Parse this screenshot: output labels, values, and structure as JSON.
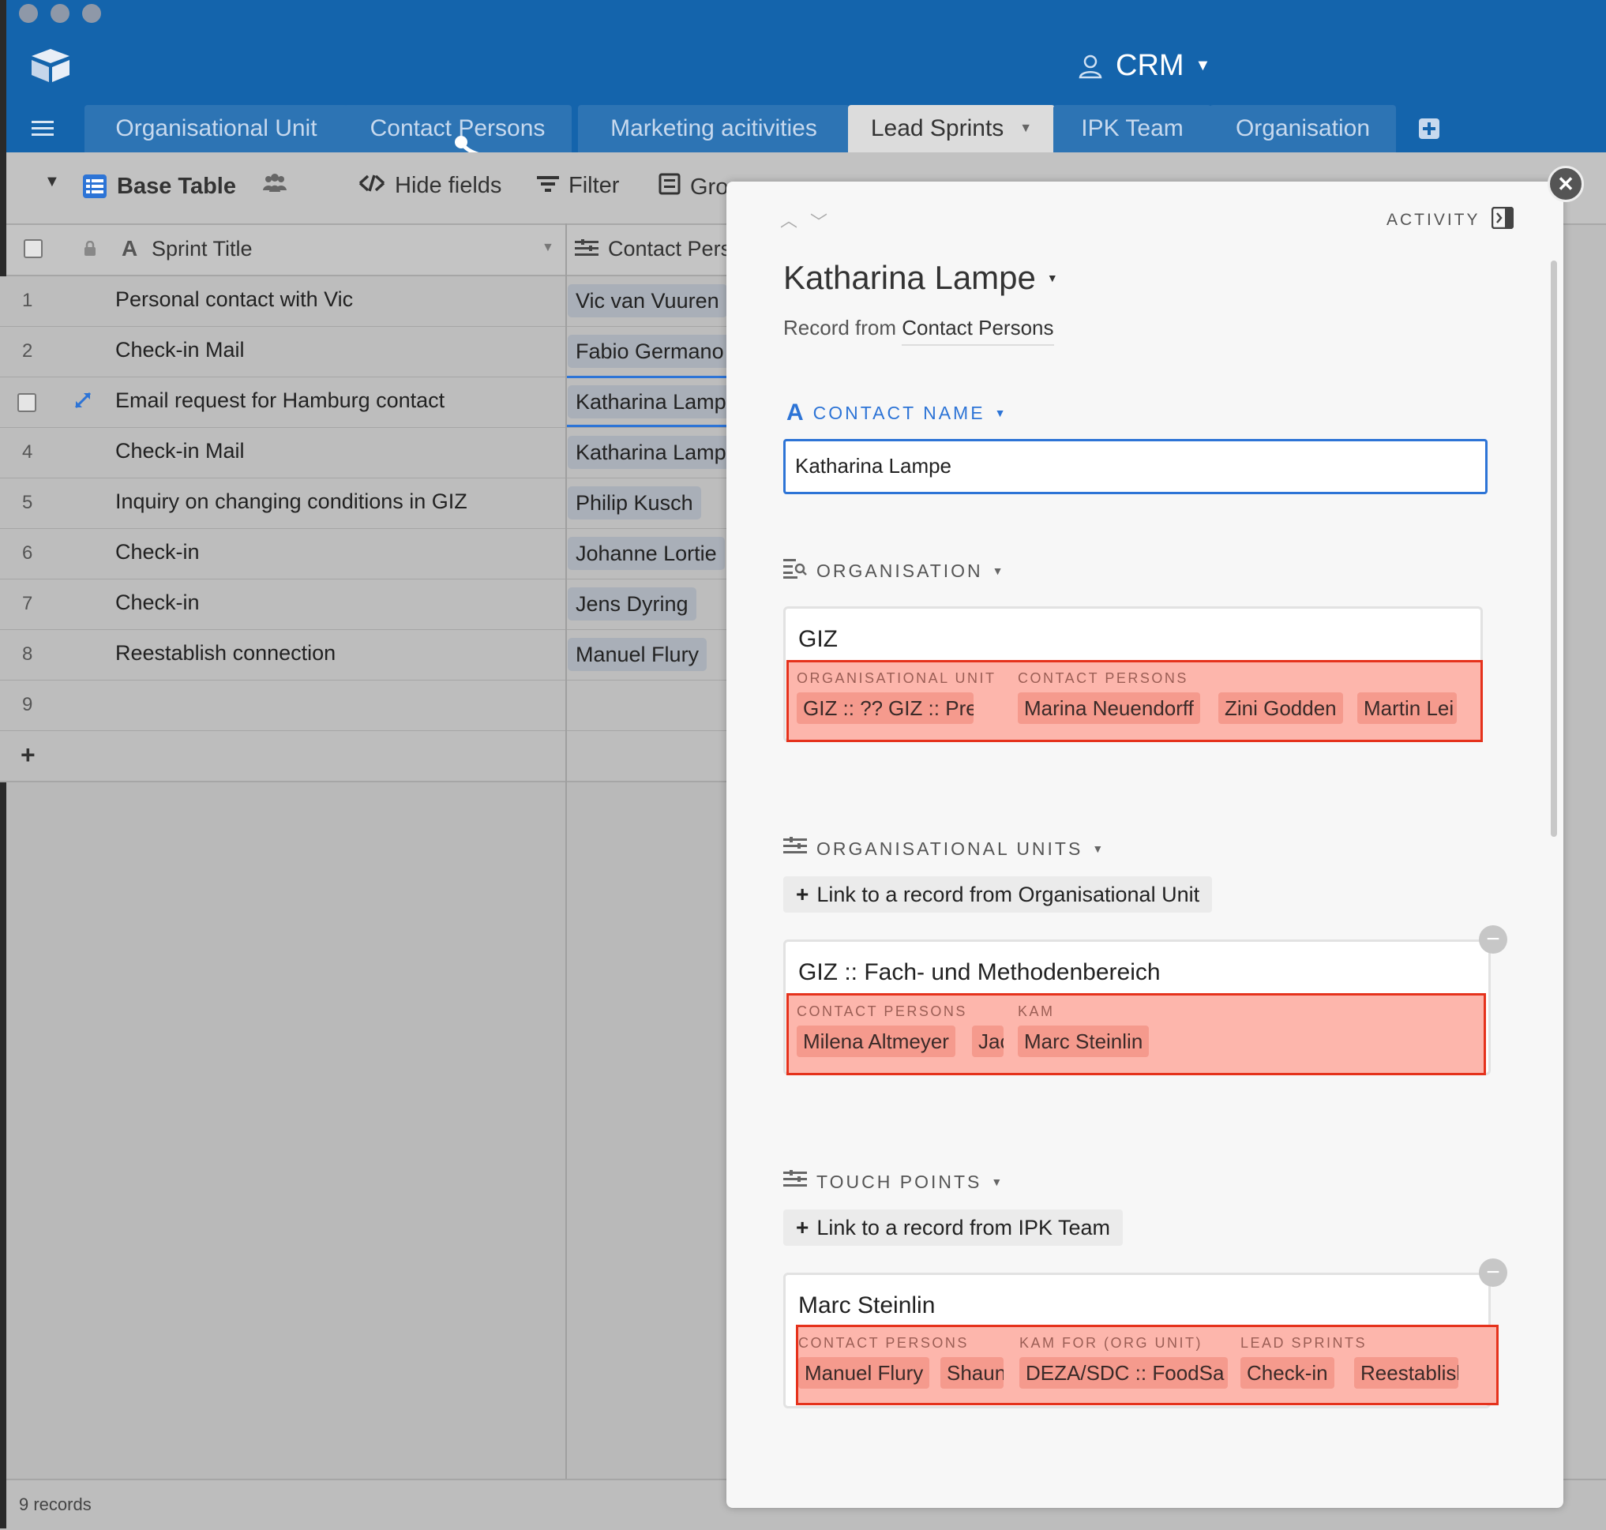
{
  "base": {
    "name": "CRM"
  },
  "tabs": [
    {
      "label": "Organisational Unit"
    },
    {
      "label": "Contact Persons"
    },
    {
      "label": "Marketing acitivities"
    },
    {
      "label": "Lead Sprints"
    },
    {
      "label": "IPK Team"
    },
    {
      "label": "Organisation"
    }
  ],
  "toolbar": {
    "view_name": "Base Table",
    "hide_fields": "Hide fields",
    "filter": "Filter",
    "group": "Group"
  },
  "grid": {
    "columns": [
      {
        "label": "Sprint Title"
      },
      {
        "label": "Contact Persons"
      }
    ],
    "rows": [
      {
        "num": "1",
        "title": "Personal contact with Vic",
        "contact": "Vic van Vuuren"
      },
      {
        "num": "2",
        "title": "Check-in Mail",
        "contact": "Fabio Germano"
      },
      {
        "num": "",
        "title": "Email request for Hamburg contact",
        "contact": "Katharina Lampe"
      },
      {
        "num": "4",
        "title": "Check-in Mail",
        "contact": "Katharina Lampe"
      },
      {
        "num": "5",
        "title": "Inquiry on changing conditions in GIZ",
        "contact": "Philip Kusch"
      },
      {
        "num": "6",
        "title": "Check-in",
        "contact": "Johanne Lortie"
      },
      {
        "num": "7",
        "title": "Check-in",
        "contact": "Jens Dyring"
      },
      {
        "num": "8",
        "title": "Reestablish connection",
        "contact": "Manuel Flury"
      },
      {
        "num": "9",
        "title": "",
        "contact": ""
      }
    ],
    "add_row": "+",
    "record_count": "9 records"
  },
  "record": {
    "activity_label": "ACTIVITY",
    "title": "Katharina Lampe",
    "subtitle_prefix": "Record from",
    "subtitle_table": "Contact Persons",
    "contact_name": {
      "label": "CONTACT NAME",
      "value": "Katharina Lampe"
    },
    "organisation": {
      "label": "ORGANISATION",
      "card_title": "GIZ",
      "groups": [
        {
          "label": "ORGANISATIONAL UNIT",
          "items": [
            "GIZ :: ???",
            "GIZ :: Pre"
          ]
        },
        {
          "label": "CONTACT PERSONS",
          "items": [
            "Marina Neuendorff",
            "Zini Godden",
            "Martin Lei"
          ]
        }
      ]
    },
    "org_units": {
      "label": "ORGANISATIONAL UNITS",
      "link_button": "Link to a record from Organisational Unit",
      "card_title": "GIZ :: Fach- und Methodenbereich",
      "groups": [
        {
          "label": "CONTACT PERSONS",
          "items": [
            "Milena Altmeyer",
            "Jac"
          ]
        },
        {
          "label": "KAM",
          "items": [
            "Marc Steinlin"
          ]
        }
      ]
    },
    "touch_points": {
      "label": "TOUCH POINTS",
      "link_button": "Link to a record from IPK Team",
      "card_title": "Marc Steinlin",
      "groups": [
        {
          "label": "CONTACT PERSONS",
          "items": [
            "Manuel Flury",
            "Shaun"
          ]
        },
        {
          "label": "KAM FOR (ORG UNIT)",
          "items": [
            "DEZA/SDC :: FoodSa"
          ]
        },
        {
          "label": "LEAD SPRINTS",
          "items": [
            "Check-in",
            "Reestablish"
          ]
        }
      ]
    }
  },
  "colors": {
    "header_blue": "#1464ac",
    "highlight_border": "#e5321c",
    "highlight_fill": "#fdb6ac",
    "link_pill": "#a9afb8"
  }
}
